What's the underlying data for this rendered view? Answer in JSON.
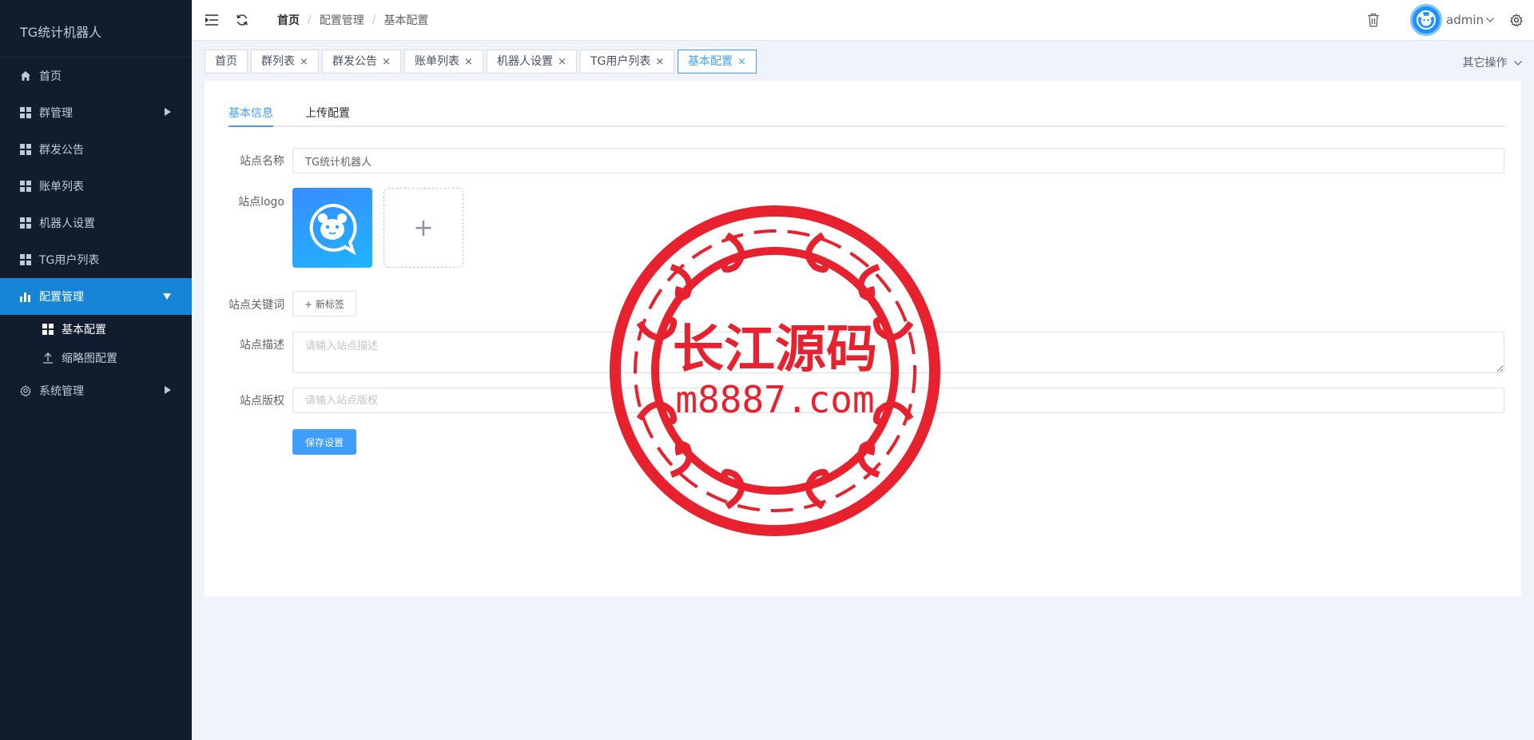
{
  "app": {
    "title": "TG统计机器人"
  },
  "sidebar": {
    "items": [
      {
        "label": "首页",
        "icon": "home-icon"
      },
      {
        "label": "群管理",
        "icon": "grid-icon"
      },
      {
        "label": "群发公告",
        "icon": "grid-icon"
      },
      {
        "label": "账单列表",
        "icon": "grid-icon"
      },
      {
        "label": "机器人设置",
        "icon": "grid-icon"
      },
      {
        "label": "TG用户列表",
        "icon": "grid-icon"
      },
      {
        "label": "配置管理",
        "icon": "bar-chart-icon"
      },
      {
        "label": "系统管理",
        "icon": "gear-icon"
      }
    ],
    "submenu": [
      {
        "label": "基本配置",
        "icon": "grid-icon"
      },
      {
        "label": "缩略图配置",
        "icon": "upload-icon"
      }
    ]
  },
  "header": {
    "breadcrumb": [
      "首页",
      "配置管理",
      "基本配置"
    ],
    "user": "admin"
  },
  "tags": {
    "items": [
      {
        "label": "首页",
        "closable": false
      },
      {
        "label": "群列表",
        "closable": true
      },
      {
        "label": "群发公告",
        "closable": true
      },
      {
        "label": "账单列表",
        "closable": true
      },
      {
        "label": "机器人设置",
        "closable": true
      },
      {
        "label": "TG用户列表",
        "closable": true
      },
      {
        "label": "基本配置",
        "closable": true
      }
    ],
    "close_glyph": "×",
    "more": "其它操作"
  },
  "tabs": [
    "基本信息",
    "上传配置"
  ],
  "form": {
    "site_name_label": "站点名称",
    "site_name_value": "TG统计机器人",
    "site_logo_label": "站点logo",
    "upload_plus": "+",
    "keywords_label": "站点关键词",
    "new_tag": "+ 新标签",
    "description_label": "站点描述",
    "description_placeholder": "请输入站点描述",
    "copyright_label": "站点版权",
    "copyright_placeholder": "请输入站点版权",
    "save": "保存设置"
  },
  "watermark": {
    "line1": "长江源码",
    "line2": "m8887.com",
    "color": "#e8212e"
  },
  "colors": {
    "sidebar_bg": "#111c2e",
    "accent": "#409eff",
    "active_menu": "#1785d6"
  }
}
